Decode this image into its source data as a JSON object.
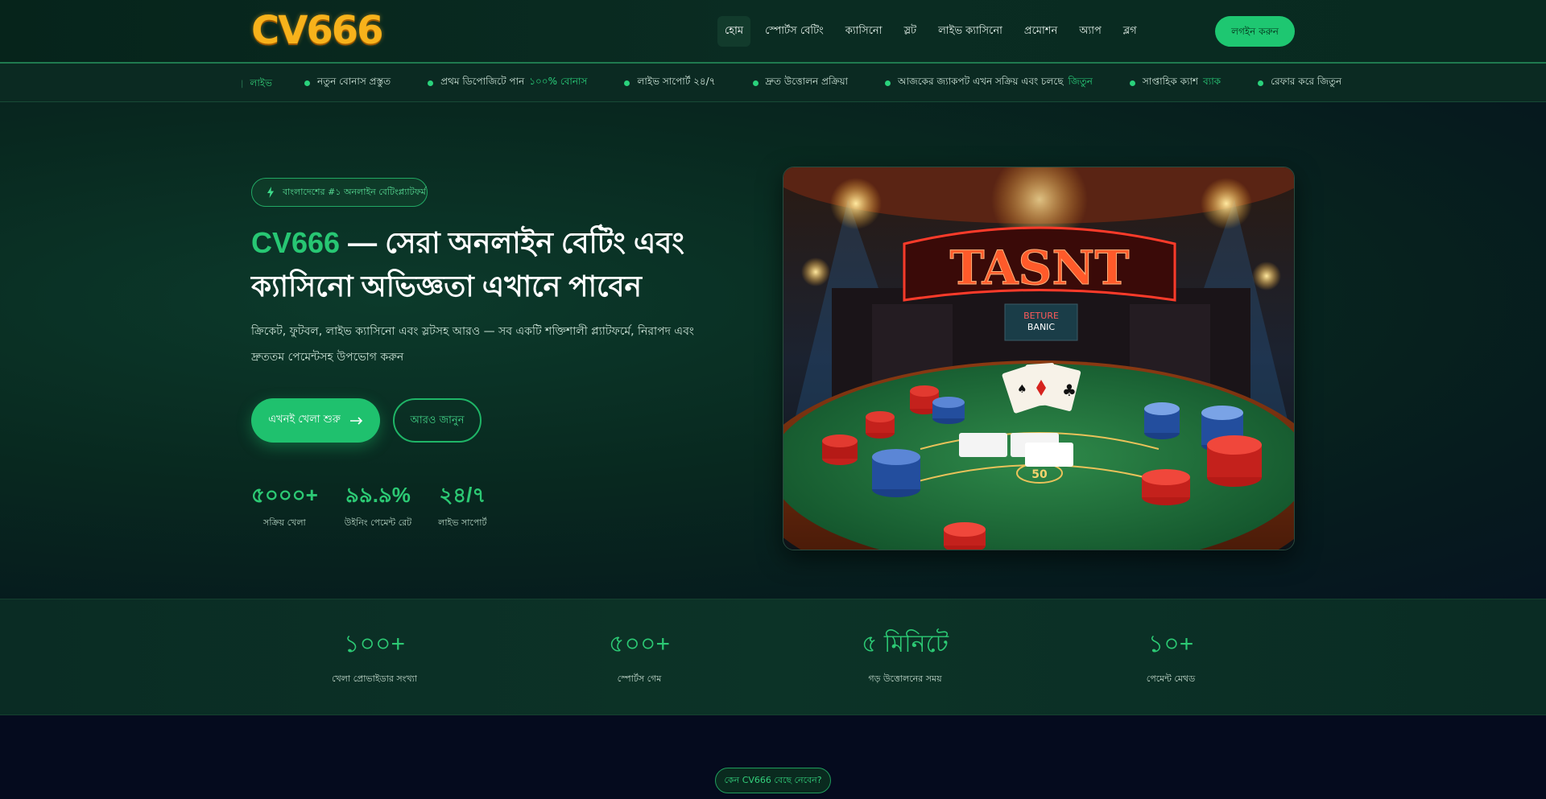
{
  "header": {
    "logo_text": "CV666",
    "nav": [
      "হোম",
      "স্পোর্টস বেটিং",
      "ক্যাসিনো",
      "স্লট",
      "লাইভ ক্যাসিনো",
      "প্রমোশন",
      "অ্যাপ",
      "ব্লগ"
    ],
    "login_label": "লগইন করুন"
  },
  "ticker": {
    "tag": "লাইভ",
    "items": [
      {
        "text": "নতুন বোনাস প্রস্তুত",
        "hl": ""
      },
      {
        "text": "প্রথম ডিপোজিটে পান",
        "hl": "১০০% বোনাস"
      },
      {
        "text": "লাইভ সাপোর্ট ২৪/৭",
        "hl": ""
      },
      {
        "text": "দ্রুত উত্তোলন প্রক্রিয়া",
        "hl": ""
      },
      {
        "text": "আজকের জ্যাকপট এখন সক্রিয় এবং চলছে",
        "hl": "জিতুন"
      },
      {
        "text": "সাপ্তাহিক ক্যাশ",
        "hl": "ব্যাক"
      },
      {
        "text": "রেফার করে জিতুন",
        "hl": ""
      }
    ]
  },
  "hero": {
    "badge": "বাংলাদেশের #১ অনলাইন বেটিংপ্ল্যাটফর্ম",
    "title_brand": "CV666",
    "title_rest": " — সেরা অনলাইন বেটিং এবং ক্যাসিনো অভিজ্ঞতা এখানে পাবেন",
    "description": "ক্রিকেট, ফুটবল, লাইভ ক্যাসিনো এবং স্লটসহ আরও — সব একটি শক্তিশালী প্ল্যাটফর্মে, নিরাপদ এবং দ্রুততম পেমেন্টসহ উপভোগ করুন",
    "primary_button": "এখনই খেলা শুরু",
    "secondary_button": "আরও জানুন",
    "stats": [
      {
        "value": "৫০০০+",
        "label": "সক্রিয় খেলা"
      },
      {
        "value": "৯৯.৯%",
        "label": "উইনিং পেমেন্ট রেট"
      },
      {
        "value": "২৪/৭",
        "label": "লাইভ সাপোর্ট"
      }
    ],
    "image": {
      "sign_text": "TASNT",
      "screen_text_1": "BETURE",
      "screen_text_2": "BANIC",
      "chip_label": "50"
    }
  },
  "stats_band": [
    {
      "value": "১০০+",
      "label": "খেলা প্রোভাইডার সংখ্যা"
    },
    {
      "value": "৫০০+",
      "label": "স্পোর্টস গেম"
    },
    {
      "value": "৫ মিনিটে",
      "label": "গড় উত্তোলনের সময়"
    },
    {
      "value": "১০+",
      "label": "পেমেন্ট মেথড"
    }
  ],
  "why_section": {
    "pill": "কেন CV666 বেছে নেবেন?"
  },
  "colors": {
    "accent": "#1ec771",
    "logo": "#f7b21b",
    "background": "#04121a"
  }
}
